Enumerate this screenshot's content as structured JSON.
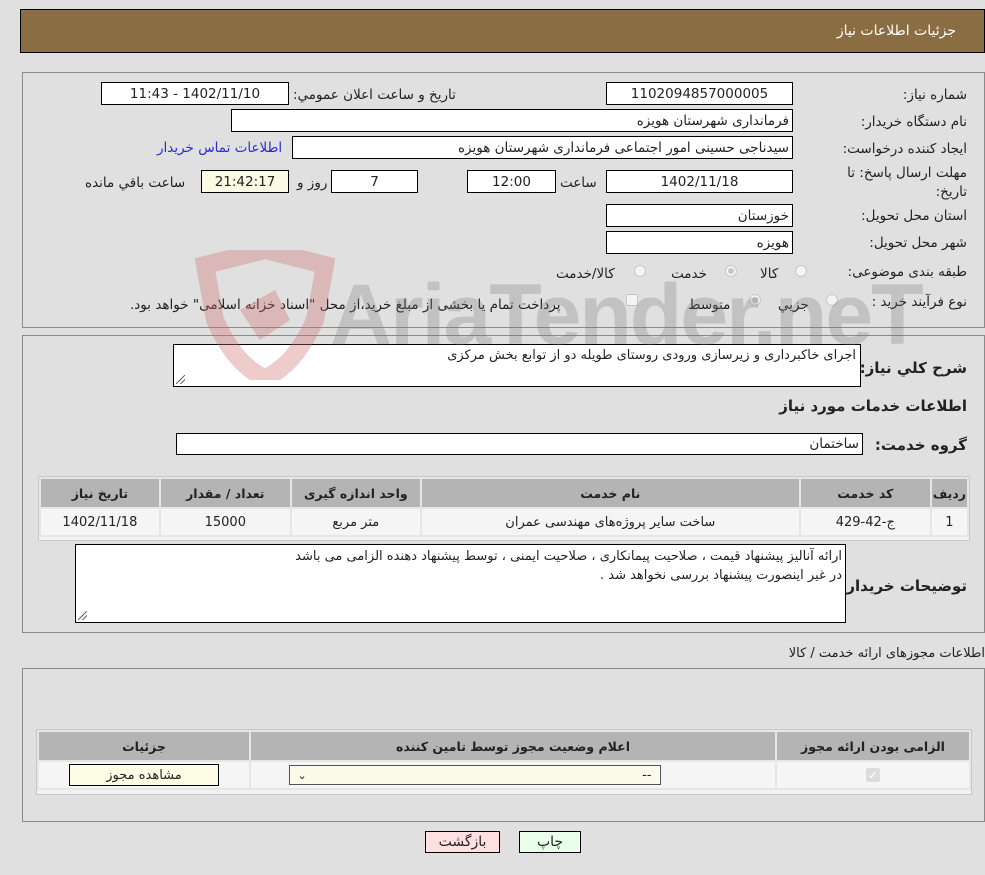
{
  "header": {
    "title": "جزئیات اطلاعات نیاز"
  },
  "fields": {
    "need_number_label": "شماره نیاز:",
    "need_number": "1102094857000005",
    "announce_label": "تاریخ و ساعت اعلان عمومي:",
    "announce_value": "1402/11/10 - 11:43",
    "buyer_org_label": "نام دستگاه خريدار:",
    "buyer_org": "فرمانداری شهرستان هویزه",
    "creator_label": "ایجاد کننده درخواست:",
    "creator": "سیدناجی حسینی امور اجتماعی فرمانداری شهرستان هویزه",
    "contact_link": "اطلاعات تماس خريدار",
    "deadline_label": "مهلت ارسال پاسخ: تا تاریخ:",
    "deadline_date": "1402/11/18",
    "time_label": "ساعت",
    "deadline_time": "12:00",
    "days_value": "7",
    "days_label": "روز و",
    "remaining_time": "21:42:17",
    "remaining_label": "ساعت باقي مانده",
    "province_label": "استان محل تحویل:",
    "province": "خوزستان",
    "city_label": "شهر محل تحویل:",
    "city": "هویزه",
    "category_label": "طبقه بندی موضوعی:",
    "category_options": [
      {
        "label": "کالا",
        "selected": false
      },
      {
        "label": "خدمت",
        "selected": true
      },
      {
        "label": "کالا/خدمت",
        "selected": false
      }
    ],
    "process_label": "نوع فرآیند خرید :",
    "process_options": [
      {
        "label": "جزيي",
        "selected": false
      },
      {
        "label": "متوسط",
        "selected": true
      }
    ],
    "treasury_note": "پرداخت تمام یا بخشی از مبلغ خرید،از محل \"اسناد خزانه اسلامی\" خواهد بود.",
    "treasury_checked": false
  },
  "description": {
    "label": "شرح کلي نياز:",
    "value": "اجرای خاکبرداری و زیرسازی ورودی روستای طویله دو از توابع بخش مرکزی",
    "services_heading": "اطلاعات خدمات مورد نياز",
    "service_group_label": "گروه خدمت:",
    "service_group": "ساختمان"
  },
  "services_table": {
    "headers": [
      "رديف",
      "کد خدمت",
      "نام خدمت",
      "واحد اندازه گيری",
      "تعداد / مقدار",
      "تاريخ نياز"
    ],
    "rows": [
      [
        "1",
        "ج-42-429",
        "ساخت سایر پروژه‌های مهندسی عمران",
        "متر مربع",
        "15000",
        "1402/11/18"
      ]
    ]
  },
  "buyer_notes": {
    "label": "توضيحات خريدار:",
    "line1": "ارائه آنالیز پیشنهاد قیمت ، صلاحیت پیمانکاری ، صلاحیت ایمنی ، توسط پیشنهاد دهنده الزامی می باشد",
    "line2": "در غیر اینصورت پیشنهاد بررسی نخواهد شد ."
  },
  "permits": {
    "section_title": "اطلاعات مجوزهای ارائه خدمت / کالا",
    "headers": [
      "الزامی بودن ارائه مجوز",
      "اعلام وضعیت مجوز توسط تامین کننده",
      "جزئیات"
    ],
    "row": {
      "required_checked": true,
      "status_value": "--",
      "details_button": "مشاهده مجوز"
    }
  },
  "actions": {
    "print": "چاپ",
    "back": "بازگشت"
  },
  "watermark": {
    "text": "AriaTender.neT"
  },
  "colors": {
    "header_bg": "#8b6d43",
    "print_bg": "#eaffea",
    "back_bg": "#ffe0e0",
    "link": "#2a2ad6"
  }
}
